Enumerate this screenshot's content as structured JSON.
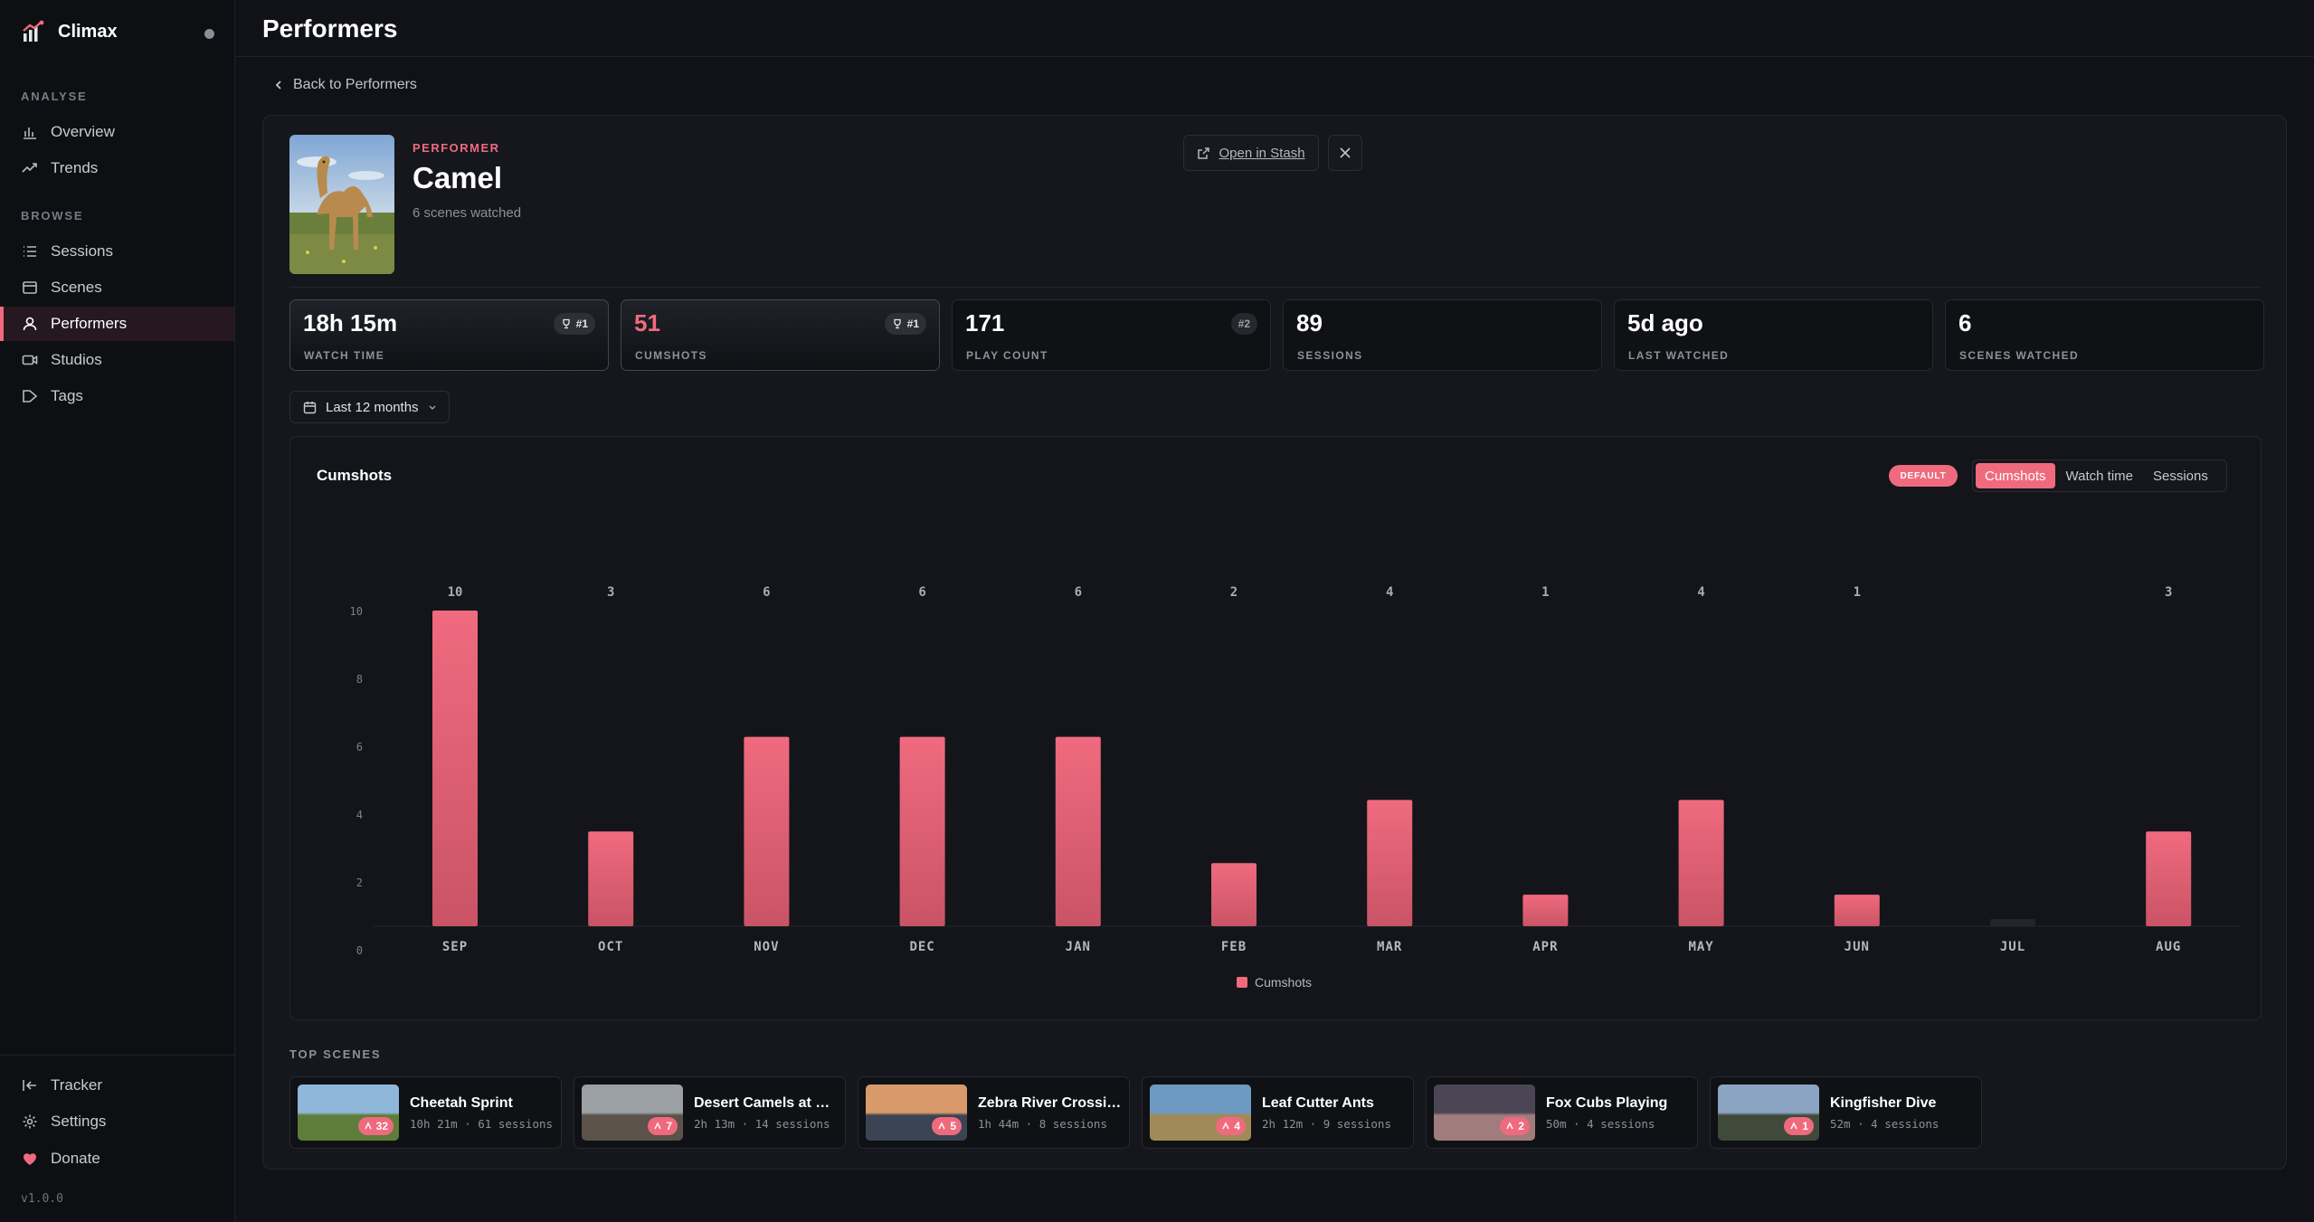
{
  "app": {
    "name": "Climax",
    "version": "v1.0.0"
  },
  "sidebar": {
    "sections": [
      {
        "label": "ANALYSE",
        "items": [
          {
            "label": "Overview",
            "icon": "bar-chart-icon"
          },
          {
            "label": "Trends",
            "icon": "trend-icon"
          }
        ]
      },
      {
        "label": "BROWSE",
        "items": [
          {
            "label": "Sessions",
            "icon": "list-icon"
          },
          {
            "label": "Scenes",
            "icon": "film-icon"
          },
          {
            "label": "Performers",
            "icon": "user-icon",
            "active": true
          },
          {
            "label": "Studios",
            "icon": "camera-icon"
          },
          {
            "label": "Tags",
            "icon": "tag-icon"
          }
        ]
      }
    ],
    "footer": [
      {
        "label": "Tracker",
        "icon": "tracker-icon"
      },
      {
        "label": "Settings",
        "icon": "gear-icon"
      },
      {
        "label": "Donate",
        "icon": "heart-icon"
      }
    ]
  },
  "header": {
    "title": "Performers"
  },
  "back_link": "Back to Performers",
  "performer": {
    "kicker": "PERFORMER",
    "name": "Camel",
    "subtitle": "6 scenes watched",
    "open_in_stash": "Open in Stash"
  },
  "stats": [
    {
      "value": "18h 15m",
      "label": "WATCH TIME",
      "rank": "#1",
      "trophy": true,
      "highlight": true
    },
    {
      "value": "51",
      "label": "CUMSHOTS",
      "rank": "#1",
      "trophy": true,
      "highlight": true,
      "accent": true
    },
    {
      "value": "171",
      "label": "PLAY COUNT",
      "rank": "#2",
      "trophy": false
    },
    {
      "value": "89",
      "label": "SESSIONS"
    },
    {
      "value": "5d ago",
      "label": "LAST WATCHED"
    },
    {
      "value": "6",
      "label": "SCENES WATCHED"
    }
  ],
  "period": {
    "label": "Last 12 months"
  },
  "chart": {
    "title": "Cumshots",
    "default_badge": "DEFAULT",
    "toggle": [
      {
        "label": "Cumshots",
        "active": true
      },
      {
        "label": "Watch time"
      },
      {
        "label": "Sessions"
      }
    ]
  },
  "chart_data": {
    "type": "bar",
    "categories": [
      "SEP",
      "OCT",
      "NOV",
      "DEC",
      "JAN",
      "FEB",
      "MAR",
      "APR",
      "MAY",
      "JUN",
      "JUL",
      "AUG"
    ],
    "series": [
      {
        "name": "Cumshots",
        "values": [
          10,
          3,
          6,
          6,
          6,
          2,
          4,
          1,
          4,
          1,
          0,
          3
        ],
        "color": "#f06a7e"
      }
    ],
    "value_labels": [
      "10",
      "3",
      "6",
      "6",
      "6",
      "2",
      "4",
      "1",
      "4",
      "1",
      "",
      "3"
    ],
    "yticks": [
      0,
      2,
      4,
      6,
      8,
      10
    ],
    "ylim": [
      0,
      10
    ],
    "legend": "bottom-center",
    "grid": false
  },
  "top_scenes": {
    "label": "TOP SCENES",
    "items": [
      {
        "title": "Cheetah Sprint",
        "meta": "10h 21m · 61 sessions",
        "count": "32"
      },
      {
        "title": "Desert Camels at Du...",
        "meta": "2h 13m · 14 sessions",
        "count": "7"
      },
      {
        "title": "Zebra River Crossing",
        "meta": "1h 44m · 8 sessions",
        "count": "5"
      },
      {
        "title": "Leaf Cutter Ants",
        "meta": "2h 12m · 9 sessions",
        "count": "4"
      },
      {
        "title": "Fox Cubs Playing",
        "meta": "50m · 4 sessions",
        "count": "2"
      },
      {
        "title": "Kingfisher Dive",
        "meta": "52m · 4 sessions",
        "count": "1"
      }
    ]
  }
}
